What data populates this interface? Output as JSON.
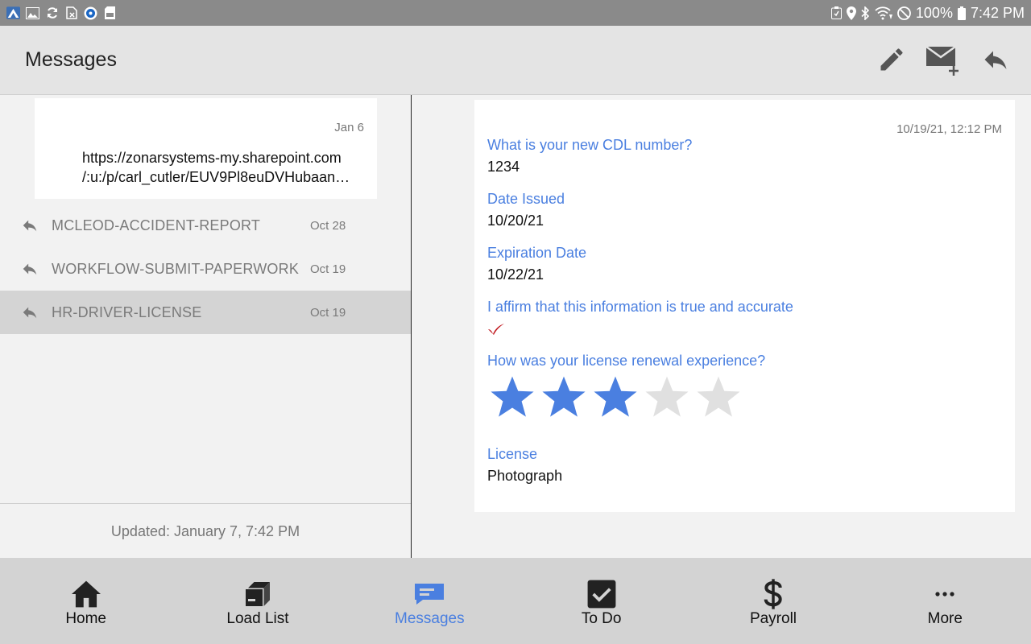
{
  "status_bar": {
    "battery": "100%",
    "time": "7:42 PM",
    "left_icons": [
      "app-icon",
      "image-icon",
      "sync-icon",
      "file-x-icon",
      "location-app-icon",
      "sd-icon"
    ],
    "right_icons": [
      "save-icon",
      "location-icon",
      "bluetooth-icon",
      "wifi-icon",
      "do-not-disturb-icon",
      "battery-icon"
    ]
  },
  "app_bar": {
    "title": "Messages",
    "actions": [
      "edit-icon",
      "new-message-icon",
      "reply-icon"
    ]
  },
  "message_list": {
    "preview": {
      "date": "Jan 6",
      "line1": "https://zonarsystems-my.sharepoint.com",
      "line2": "/:u:/p/carl_cutler/EUV9Pl8euDVHubaan…"
    },
    "items": [
      {
        "subject": "MCLEOD-ACCIDENT-REPORT",
        "date": "Oct 28"
      },
      {
        "subject": "WORKFLOW-SUBMIT-PAPERWORK",
        "date": "Oct 19"
      },
      {
        "subject": "HR-DRIVER-LICENSE",
        "date": "Oct 19"
      }
    ],
    "updated": "Updated: January 7, 7:42 PM"
  },
  "detail": {
    "timestamp": "10/19/21, 12:12 PM",
    "fields": [
      {
        "question": "What is your new CDL number?",
        "answer": "1234"
      },
      {
        "question": "Date Issued",
        "answer": "10/20/21"
      },
      {
        "question": "Expiration Date",
        "answer": "10/22/21"
      },
      {
        "question": "I affirm that this information is true and accurate",
        "answer_icon": "checkmark-icon"
      },
      {
        "question": "How was your license renewal experience?",
        "rating": 3,
        "rating_max": 5
      },
      {
        "question": "License",
        "answer": "Photograph"
      }
    ]
  },
  "bottom_nav": {
    "items": [
      {
        "label": "Home",
        "icon": "home-icon"
      },
      {
        "label": "Load List",
        "icon": "box-icon"
      },
      {
        "label": "Messages",
        "icon": "messages-icon",
        "active": true
      },
      {
        "label": "To Do",
        "icon": "checkbox-icon"
      },
      {
        "label": "Payroll",
        "icon": "dollar-icon"
      },
      {
        "label": "More",
        "icon": "more-icon"
      }
    ]
  },
  "colors": {
    "accent": "#4a7fe0",
    "status_bar": "#8a8a8a",
    "app_bar": "#e4e4e4",
    "nav_bar": "#d3d3d3",
    "star_on": "#4a7fe0",
    "star_off": "#e0e0e0",
    "check": "#c0161c"
  }
}
